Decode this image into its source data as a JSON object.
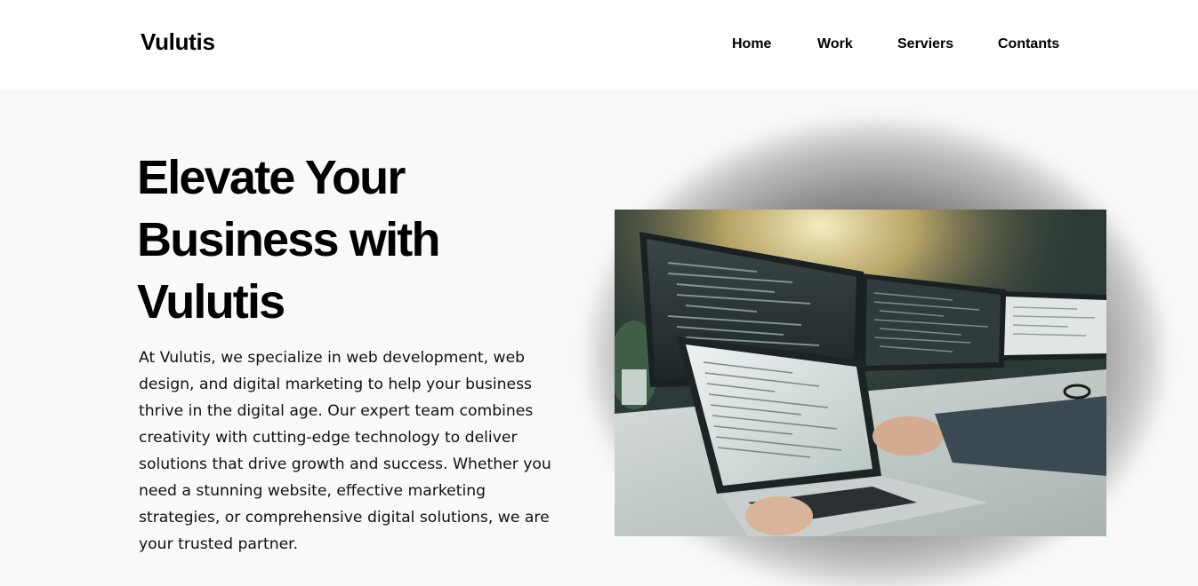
{
  "header": {
    "brand": "Vulutis",
    "nav": {
      "home": "Home",
      "work": "Work",
      "services": "Serviers",
      "contacts": "Contants"
    }
  },
  "hero": {
    "title_line1": "Elevate Your",
    "title_line2": "Business with",
    "title_line3": "Vulutis",
    "description": "At Vulutis, we specialize in web development, web design, and digital marketing to help your business thrive in the digital age. Our expert team combines creativity with cutting-edge technology to deliver solutions that drive growth and success. Whether you need a stunning website, effective marketing strategies, or comprehensive digital solutions, we are your trusted partner."
  },
  "colors": {
    "page_background": "#f9f9f9",
    "header_background": "#ffffff",
    "text": "#000000"
  },
  "icons": {
    "hero_image": "laptop-coding-photo"
  }
}
